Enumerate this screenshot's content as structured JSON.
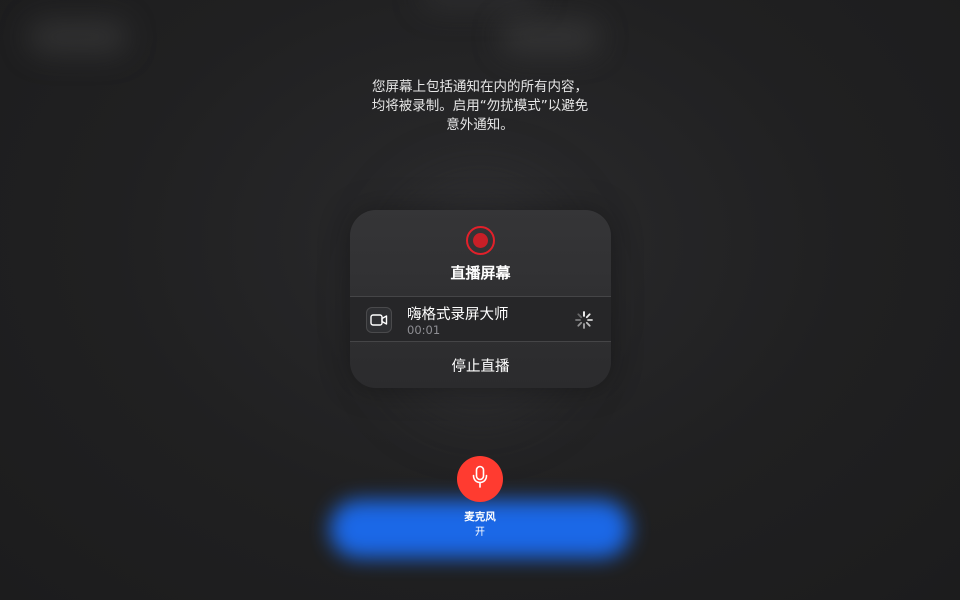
{
  "notice": {
    "line1": "您屏幕上包括通知在内的所有内容，",
    "line2": "均将被录制。启用“勿扰模式”以避免",
    "line3": "意外通知。"
  },
  "broadcast": {
    "title": "直播屏幕",
    "record_icon": "record-icon",
    "app": {
      "name": "嗨格式录屏大师",
      "elapsed": "00:01",
      "icon": "video-camera-icon",
      "status_icon": "loading-spinner-icon"
    },
    "stop_label": "停止直播"
  },
  "microphone": {
    "label": "麦克风",
    "state": "开",
    "icon": "microphone-icon",
    "color": "#ff3b30"
  },
  "colors": {
    "record_red": "#e2202a",
    "background": "#202021",
    "accent_blue": "#1b6cf2"
  }
}
